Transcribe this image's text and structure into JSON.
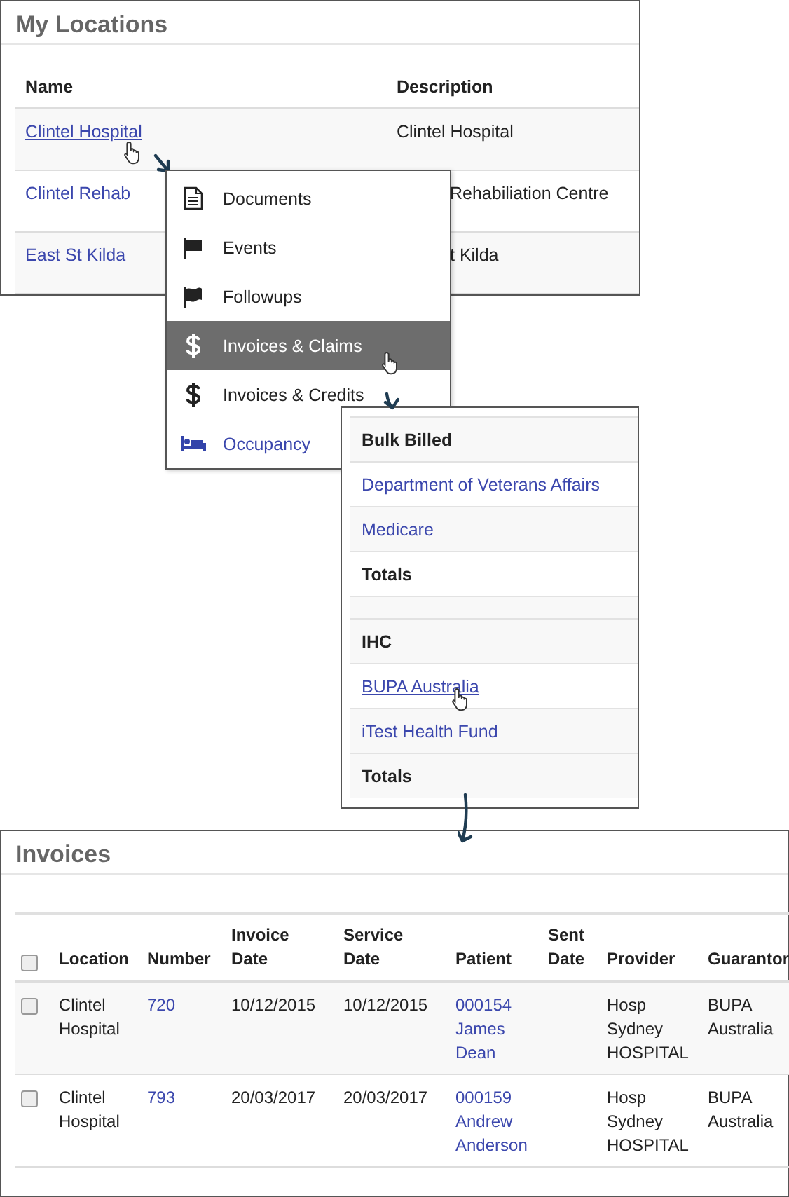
{
  "locations": {
    "title": "My Locations",
    "columns": [
      "Name",
      "Description"
    ],
    "rows": [
      {
        "name": "Clintel Hospital",
        "description": "Clintel Hospital",
        "hovered": true,
        "covered": false
      },
      {
        "name": "Clintel Rehab",
        "description": "Rehabiliation Centre",
        "hovered": false,
        "covered": true
      },
      {
        "name": "East St Kilda",
        "description": "t Kilda",
        "hovered": false,
        "covered": true
      }
    ]
  },
  "menu": {
    "items": [
      {
        "label": "Documents",
        "kind": "document",
        "selected": false,
        "link": false
      },
      {
        "label": "Events",
        "kind": "flag",
        "selected": false,
        "link": false
      },
      {
        "label": "Followups",
        "kind": "flag",
        "selected": false,
        "link": false
      },
      {
        "label": "Invoices & Claims",
        "kind": "dollar",
        "selected": true,
        "link": false
      },
      {
        "label": "Invoices & Credits",
        "kind": "dollar",
        "selected": false,
        "link": false
      },
      {
        "label": "Occupancy",
        "kind": "bed",
        "selected": false,
        "link": true
      }
    ]
  },
  "submenu": {
    "groups": [
      {
        "title": "Bulk Billed",
        "items": [
          {
            "label": "Department of Veterans Affairs",
            "hovered": false
          },
          {
            "label": "Medicare",
            "hovered": false
          }
        ],
        "total": "Totals"
      },
      {
        "title": "IHC",
        "items": [
          {
            "label": "BUPA Australia",
            "hovered": true
          },
          {
            "label": "iTest Health Fund",
            "hovered": false
          }
        ],
        "total": "Totals"
      }
    ]
  },
  "invoices": {
    "title": "Invoices",
    "all_checked": false,
    "columns": [
      "Location",
      "Number",
      "Invoice Date",
      "Service Date",
      "Patient",
      "Sent Date",
      "Provider",
      "Guarantor"
    ],
    "rows": [
      {
        "checked": false,
        "location": "Clintel Hospital",
        "number": "720",
        "invoice_date": "10/12/2015",
        "service_date": "10/12/2015",
        "patient": "000154 James Dean",
        "provider": "Hosp Sydney HOSPITAL",
        "guarantor": "BUPA Australia"
      },
      {
        "checked": false,
        "location": "Clintel Hospital",
        "number": "793",
        "invoice_date": "20/03/2017",
        "service_date": "20/03/2017",
        "patient": "000159 Andrew Anderson",
        "provider": "Hosp Sydney HOSPITAL",
        "guarantor": "BUPA Australia"
      }
    ]
  }
}
